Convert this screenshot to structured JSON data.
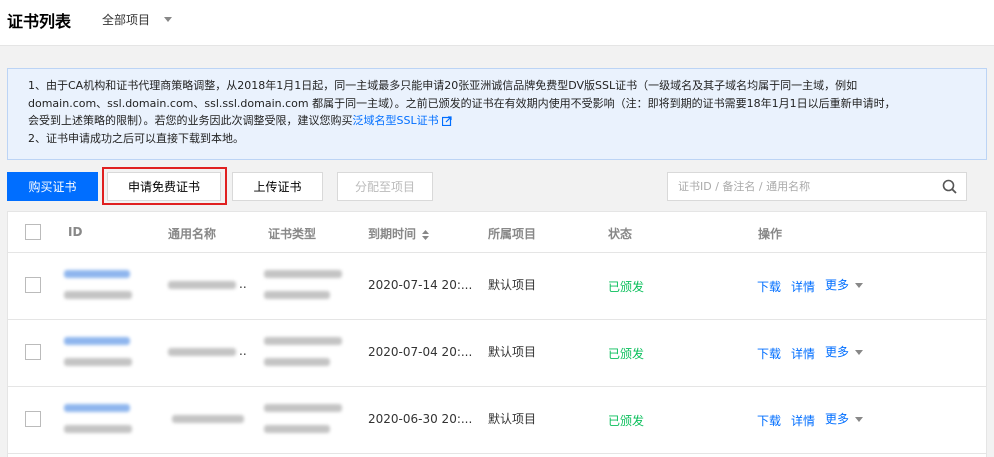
{
  "header": {
    "title": "证书列表",
    "project_select": "全部项目"
  },
  "notice": {
    "line1": "1、由于CA机构和证书代理商策略调整，从2018年1月1日起，同一主域最多只能申请20张亚洲诚信品牌免费型DV版SSL证书（一级域名及其子域名均属于同一主域，例如",
    "line2": "domain.com、ssl.domain.com、ssl.ssl.domain.com 都属于同一主域）。之前已颁发的证书在有效期内使用不受影响（注：即将到期的证书需要18年1月1日以后重新申请时，",
    "line3_prefix": "会受到上述策略的限制）。若您的业务因此次调整受限，建议您购买",
    "line3_link": "泛域名型SSL证书",
    "line4": "2、证书申请成功之后可以直接下载到本地。"
  },
  "toolbar": {
    "buy": "购买证书",
    "apply_free": "申请免费证书",
    "upload": "上传证书",
    "assign": "分配至项目",
    "search_placeholder": "证书ID / 备注名 / 通用名称"
  },
  "table": {
    "headers": [
      "ID",
      "通用名称",
      "证书类型",
      "到期时间",
      "所属项目",
      "状态",
      "操作"
    ],
    "rows": [
      {
        "common_name_suffix": "..",
        "expire": "2020-07-14 20:...",
        "project": "默认项目",
        "status": "已颁发"
      },
      {
        "common_name_suffix": "..",
        "expire": "2020-07-04 20:...",
        "project": "默认项目",
        "status": "已颁发"
      },
      {
        "common_name_suffix": "",
        "expire": "2020-06-30 20:...",
        "project": "默认项目",
        "status": "已颁发"
      }
    ],
    "ops": {
      "download": "下载",
      "detail": "详情",
      "more": "更多"
    }
  },
  "colors": {
    "primary": "#006eff",
    "success": "#0abf5b",
    "highlight": "#e02020"
  }
}
